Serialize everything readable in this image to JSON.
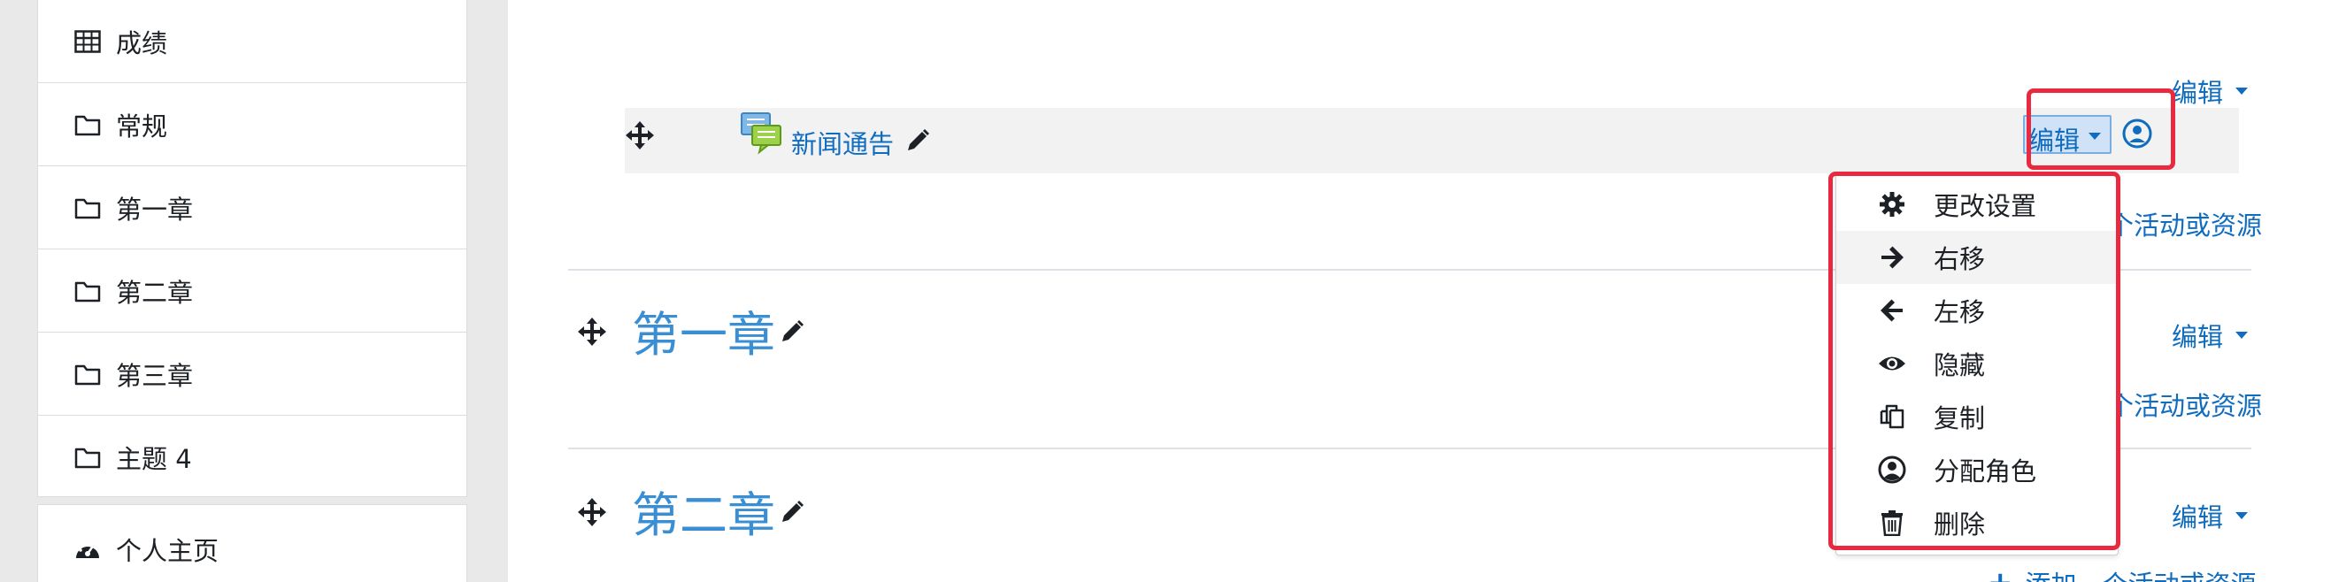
{
  "sidebar": {
    "items": [
      {
        "label": "成绩",
        "icon": "table-icon"
      },
      {
        "label": "常规",
        "icon": "folder-icon"
      },
      {
        "label": "第一章",
        "icon": "folder-icon"
      },
      {
        "label": "第二章",
        "icon": "folder-icon"
      },
      {
        "label": "第三章",
        "icon": "folder-icon"
      },
      {
        "label": "主题 4",
        "icon": "folder-icon"
      }
    ],
    "dashboard": {
      "label": "个人主页",
      "icon": "dashboard-icon"
    }
  },
  "main": {
    "general_section": {
      "edit_label": "编辑",
      "news_activity": {
        "title": "新闻通告",
        "edit_label": "编辑"
      },
      "add_link": "个活动或资源"
    },
    "sections": [
      {
        "title": "第一章",
        "edit_label": "编辑",
        "add_link": "个活动或资源"
      },
      {
        "title": "第二章",
        "edit_label": "编辑",
        "add_link": "添加一个活动或资源"
      }
    ],
    "dropdown": {
      "items": [
        {
          "label": "更改设置",
          "icon": "gear-icon"
        },
        {
          "label": "右移",
          "icon": "arrow-right-icon"
        },
        {
          "label": "左移",
          "icon": "arrow-left-icon"
        },
        {
          "label": "隐藏",
          "icon": "eye-icon"
        },
        {
          "label": "复制",
          "icon": "copy-icon"
        },
        {
          "label": "分配角色",
          "icon": "user-circle-icon"
        },
        {
          "label": "删除",
          "icon": "trash-icon"
        }
      ]
    }
  },
  "colors": {
    "accent": "#0f6cbf",
    "highlight": "#e8293f",
    "section_title": "#3a8fd4"
  }
}
